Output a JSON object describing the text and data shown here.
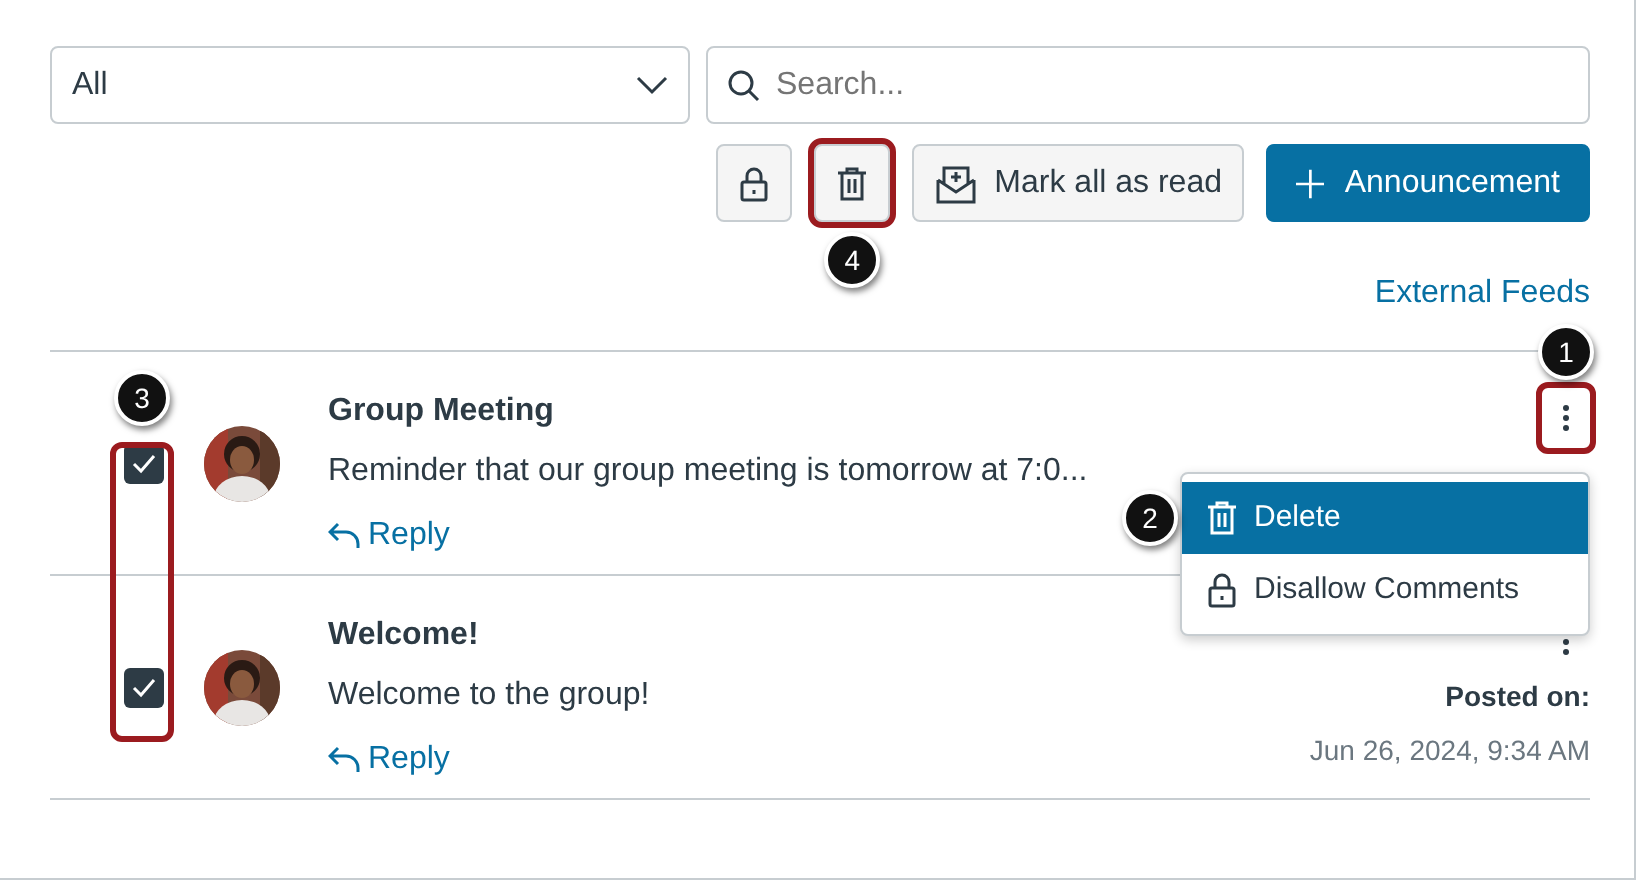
{
  "filter": {
    "value": "All"
  },
  "search": {
    "placeholder": "Search..."
  },
  "toolbar": {
    "delete_button": {
      "highlighted": true,
      "callout": "4"
    },
    "mark_read_button": {
      "label": "Mark all as read"
    },
    "new_button": {
      "label": "Announcement"
    }
  },
  "external_feeds": "External Feeds",
  "checkbox_highlight": {
    "highlighted": true,
    "callout": "3"
  },
  "announcements": [
    {
      "title": "Group Meeting",
      "message": "Reminder that our group meeting is tomorrow at 7:0...",
      "reply": "Reply",
      "checked": true,
      "menu_highlighted": true,
      "menu_callout": "1",
      "menu_open": true
    },
    {
      "title": "Welcome!",
      "message": "Welcome to the group!",
      "reply": "Reply",
      "checked": true,
      "menu_highlighted": false,
      "menu_open": false,
      "posted_label": "Posted on:",
      "posted_date": "Jun 26, 2024, 9:34 AM"
    }
  ],
  "menu": {
    "items": [
      {
        "label": "Delete",
        "kind": "trash",
        "selected": true,
        "callout": "2"
      },
      {
        "label": "Disallow Comments",
        "kind": "lock",
        "selected": false
      }
    ]
  }
}
